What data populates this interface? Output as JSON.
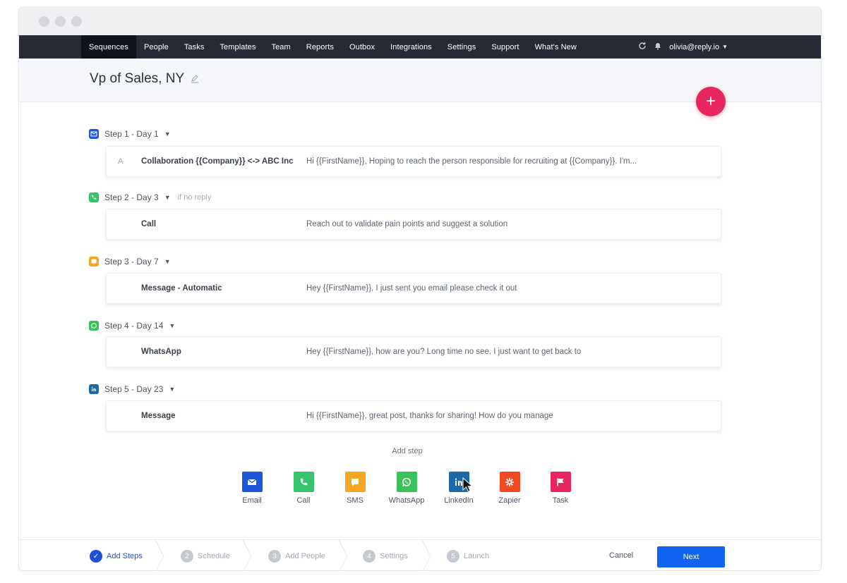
{
  "nav": {
    "items": [
      "Sequences",
      "People",
      "Tasks",
      "Templates",
      "Team",
      "Reports",
      "Outbox",
      "Integrations",
      "Settings",
      "Support",
      "What's New"
    ],
    "active": "Sequences",
    "user": "olivia@reply.io"
  },
  "header": {
    "title": "Vp of Sales, NY"
  },
  "steps": [
    {
      "label": "Step 1 - Day 1",
      "condition": "",
      "icon": "email-icon",
      "color": "#1d58d8",
      "letter": "A",
      "name": "Collaboration {{Company}} <-> ABC Inc",
      "text": "Hi {{FirstName}}, Hoping to reach the person responsible for recruiting at {{Company}}. I'm..."
    },
    {
      "label": "Step 2 - Day 3",
      "condition": "if no reply",
      "icon": "phone-icon",
      "color": "#35c46a",
      "letter": "",
      "name": "Call",
      "text": "Reach out to validate pain points and suggest a solution"
    },
    {
      "label": "Step 3 - Day 7",
      "condition": "",
      "icon": "sms-icon",
      "color": "#f5a623",
      "letter": "",
      "name": "Message - Automatic",
      "text": "Hey {{FirstName}}, I just sent you email please check it out"
    },
    {
      "label": "Step 4 - Day 14",
      "condition": "",
      "icon": "whatsapp-icon",
      "color": "#3ac25a",
      "letter": "",
      "name": "WhatsApp",
      "text": "Hey {{FirstName}}, how are you? Long time no see. I just want to get back to"
    },
    {
      "label": "Step 5 - Day 23",
      "condition": "",
      "icon": "linkedin-icon",
      "color": "#1b6aa5",
      "letter": "",
      "name": "Message",
      "text": "Hi {{FirstName}}, great post, thanks for sharing! How do you manage"
    }
  ],
  "add_step": {
    "label": "Add step",
    "tools": [
      {
        "label": "Email",
        "icon": "email-icon",
        "color": "#1d58d8"
      },
      {
        "label": "Call",
        "icon": "phone-icon",
        "color": "#35c46a"
      },
      {
        "label": "SMS",
        "icon": "sms-icon",
        "color": "#f5a623"
      },
      {
        "label": "WhatsApp",
        "icon": "whatsapp-icon",
        "color": "#3ac25a"
      },
      {
        "label": "LinkedIn",
        "icon": "linkedin-icon",
        "color": "#1b6aa5"
      },
      {
        "label": "Zapier",
        "icon": "zapier-icon",
        "color": "#f04a23"
      },
      {
        "label": "Task",
        "icon": "flag-icon",
        "color": "#e8265e"
      }
    ]
  },
  "wizard": {
    "steps": [
      {
        "num": "1",
        "label": "Add Steps",
        "done": true
      },
      {
        "num": "2",
        "label": "Schedule",
        "done": false
      },
      {
        "num": "3",
        "label": "Add People",
        "done": false
      },
      {
        "num": "4",
        "label": "Settings",
        "done": false
      },
      {
        "num": "5",
        "label": "Launch",
        "done": false
      }
    ],
    "cancel": "Cancel",
    "next": "Next"
  },
  "fab_label": "+"
}
